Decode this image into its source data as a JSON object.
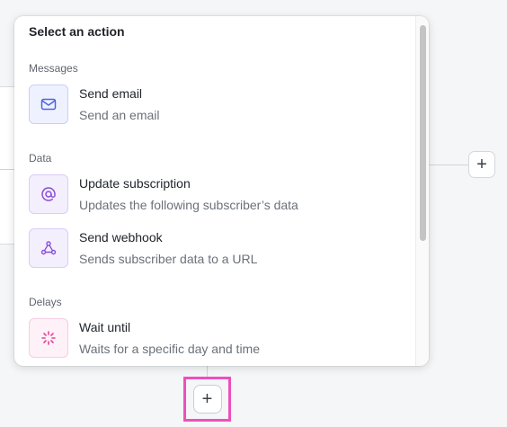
{
  "popup": {
    "title": "Select an action",
    "sections": [
      {
        "label": "Messages"
      },
      {
        "label": "Data"
      },
      {
        "label": "Delays"
      }
    ],
    "actions": [
      {
        "name": "Send email",
        "description": "Send an email",
        "icon": "envelope-icon"
      },
      {
        "name": "Update subscription",
        "description": "Updates the following subscriber’s data",
        "icon": "at-sign-icon"
      },
      {
        "name": "Send webhook",
        "description": "Sends subscriber data to a URL",
        "icon": "webhook-icon"
      },
      {
        "name": "Wait until",
        "description": "Waits for a specific day and time",
        "icon": "loading-spinner-icon"
      }
    ]
  },
  "canvas": {
    "add_right": "+",
    "add_bottom": "+"
  },
  "colors": {
    "highlight": "#ee4fbd",
    "email_icon": "#4f63d9",
    "data_icon": "#8a4fd6",
    "delay_icon": "#e6449a"
  }
}
